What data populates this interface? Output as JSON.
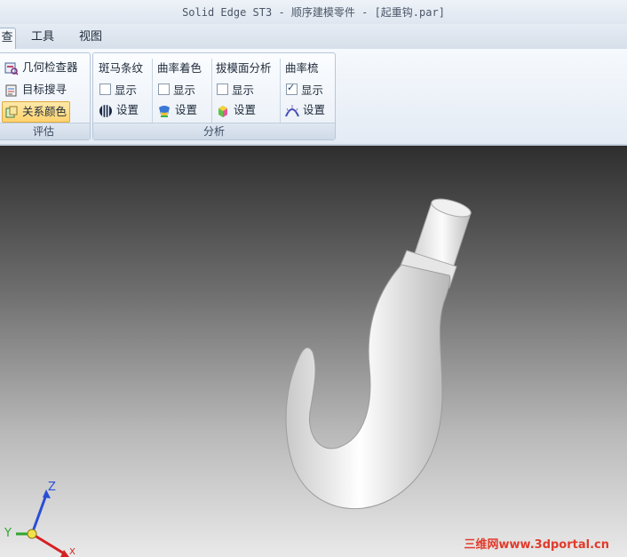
{
  "window": {
    "title": "Solid Edge ST3 - 顺序建模零件 - [起重钩.par]"
  },
  "tabs": [
    {
      "label": "查",
      "active": true
    },
    {
      "label": "工具",
      "active": false
    },
    {
      "label": "视图",
      "active": false
    }
  ],
  "ribbon": {
    "evaluate": {
      "label": "评估",
      "buttons": [
        {
          "label": "几何检查器",
          "icon": "geometry-inspector-icon"
        },
        {
          "label": "目标搜寻",
          "icon": "goal-seek-icon"
        },
        {
          "label": "关系颜色",
          "icon": "relationship-color-icon",
          "selected": true
        }
      ]
    },
    "analysis": {
      "label": "分析",
      "sections": [
        {
          "title": "斑马条纹",
          "show_label": "显示",
          "show_checked": false,
          "settings_label": "设置",
          "icon": "zebra-stripes-icon"
        },
        {
          "title": "曲率着色",
          "show_label": "显示",
          "show_checked": false,
          "settings_label": "设置",
          "icon": "curvature-shading-icon"
        },
        {
          "title": "拔模面分析",
          "show_label": "显示",
          "show_checked": false,
          "settings_label": "设置",
          "icon": "draft-face-analysis-icon"
        },
        {
          "title": "曲率梳",
          "show_label": "显示",
          "show_checked": true,
          "settings_label": "设置",
          "icon": "curvature-comb-icon"
        }
      ]
    }
  },
  "viewport": {
    "triad": {
      "z_label": "Z",
      "y_label": "Y",
      "x_label": "X"
    },
    "watermark": "三维网www.3dportal.cn"
  },
  "colors": {
    "accent": "#ffd36e",
    "axis_x": "#d62020",
    "axis_y": "#2fa52f",
    "axis_z": "#2a4fd6"
  }
}
